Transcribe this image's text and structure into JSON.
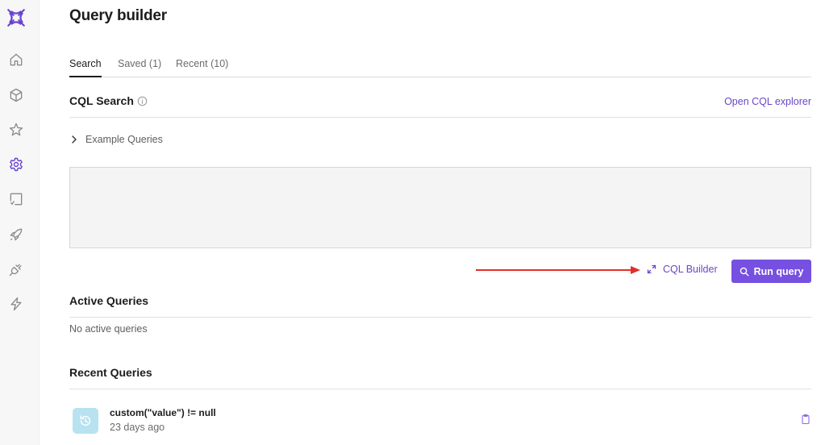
{
  "sidebar": {
    "items": [
      {
        "name": "logo",
        "icon": "logo-icon"
      },
      {
        "name": "home",
        "icon": "home-icon"
      },
      {
        "name": "catalog",
        "icon": "cube-icon"
      },
      {
        "name": "favorites",
        "icon": "star-icon"
      },
      {
        "name": "settings",
        "icon": "gear-icon",
        "active": true
      },
      {
        "name": "quality",
        "icon": "checklist-icon"
      },
      {
        "name": "launch",
        "icon": "rocket-icon"
      },
      {
        "name": "integrations",
        "icon": "plug-icon"
      },
      {
        "name": "actions",
        "icon": "lightning-icon"
      }
    ]
  },
  "header": {
    "title": "Query builder"
  },
  "tabs": [
    {
      "label": "Search",
      "active": true
    },
    {
      "label": "Saved (1)"
    },
    {
      "label": "Recent (10)"
    }
  ],
  "cql_search": {
    "title": "CQL Search",
    "explorer_link": "Open CQL explorer",
    "example_queries_label": "Example Queries",
    "editor_value": "",
    "builder_label": "CQL Builder",
    "run_label": "Run query"
  },
  "active_queries": {
    "title": "Active Queries",
    "empty_text": "No active queries"
  },
  "recent_queries": {
    "title": "Recent Queries",
    "items": [
      {
        "query": "custom(\"value\") != null",
        "time": "23 days ago"
      }
    ]
  },
  "colors": {
    "accent": "#7650e0",
    "link": "#6b45c9",
    "annotation_arrow": "#e0302a",
    "history_badge": "#b8e2f0"
  }
}
